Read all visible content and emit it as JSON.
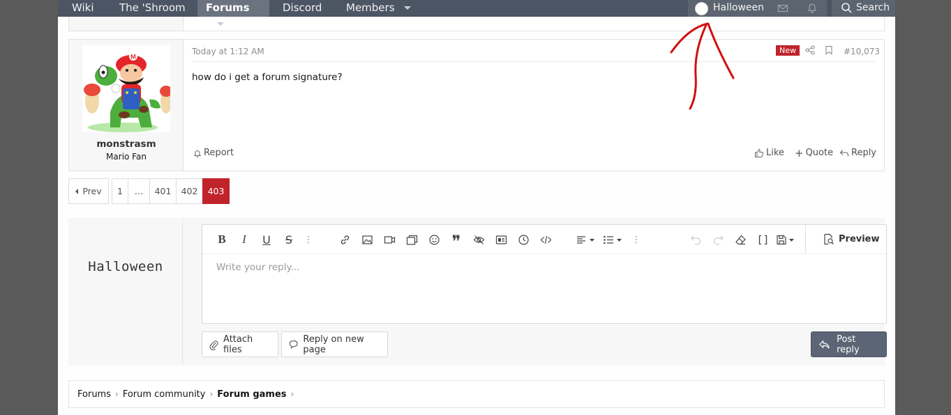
{
  "nav": {
    "items": [
      "Wiki",
      "The 'Shroom",
      "Forums",
      "Discord",
      "Members"
    ],
    "user_name": "Halloween",
    "search_label": "Search"
  },
  "post": {
    "timestamp": "Today at 1:12 AM",
    "new_badge": "New",
    "post_number": "#10,073",
    "content": "how do i get a forum signature?",
    "username": "monstrasm",
    "user_title": "Mario Fan",
    "report_label": "Report",
    "like_label": "Like",
    "quote_label": "Quote",
    "reply_label": "Reply"
  },
  "pagination": {
    "prev_label": "Prev",
    "pages": [
      "1",
      "…",
      "401",
      "402",
      "403"
    ],
    "current": "403"
  },
  "reply": {
    "signature_name": "Halloween",
    "placeholder": "Write your reply...",
    "preview_label": "Preview",
    "attach_label": "Attach files",
    "new_page_label": "Reply on new page",
    "post_label": "Post reply"
  },
  "breadcrumbs": [
    "Forums",
    "Forum community",
    "Forum games"
  ],
  "colors": {
    "accent": "#c0232b",
    "navbar": "#4b5563",
    "post_button": "#5b6576",
    "annotation": "#d01010"
  }
}
